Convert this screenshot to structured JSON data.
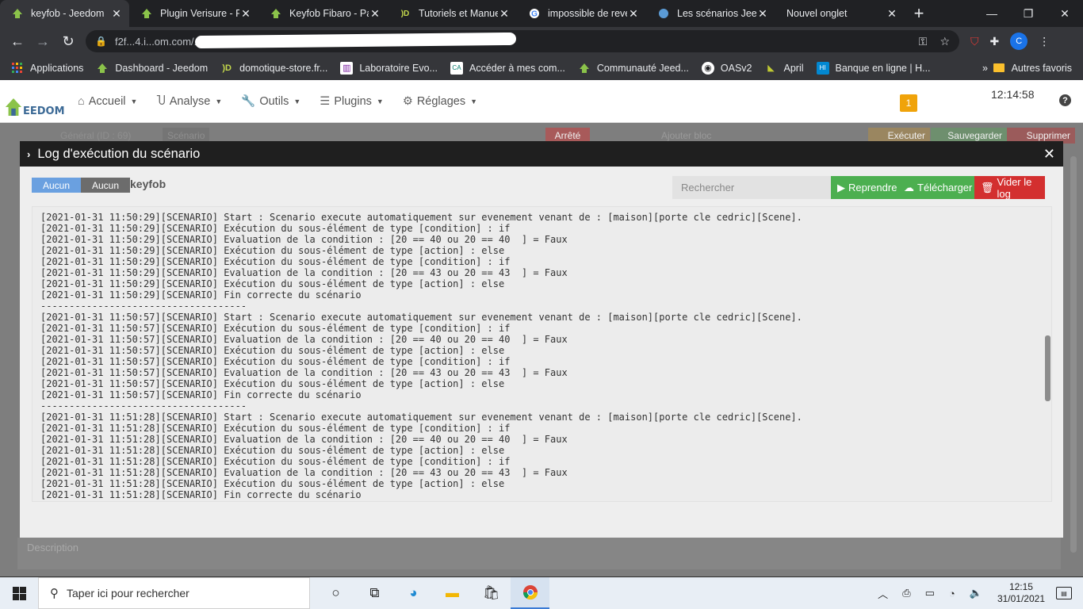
{
  "browser": {
    "tabs": [
      {
        "title": "keyfob - Jeedom",
        "active": true
      },
      {
        "title": "Plugin Verisure - P",
        "active": false
      },
      {
        "title": "Keyfob Fibaro - Pa",
        "active": false
      },
      {
        "title": "Tutoriels et Manue",
        "active": false
      },
      {
        "title": "impossible de reve",
        "active": false
      },
      {
        "title": "Les scénarios Jeed",
        "active": false
      },
      {
        "title": "Nouvel onglet",
        "active": false
      }
    ],
    "address": "f2f...4.i...om.com/...",
    "bookmarks": [
      "Applications",
      "Dashboard - Jeedom",
      "domotique-store.fr...",
      "Laboratoire Evo...",
      "Accéder à mes com...",
      "Communauté Jeed...",
      "OASv2",
      "April",
      "Banque en ligne | H..."
    ],
    "bookmarks_more": "»",
    "other_bookmarks": "Autres favoris",
    "profile_initial": "C"
  },
  "jeedom": {
    "logo_text": "EEDOM",
    "menu": [
      "Accueil",
      "Analyse",
      "Outils",
      "Plugins",
      "Réglages"
    ],
    "badge": "1",
    "clock": "12:14:58",
    "background": {
      "tab_general": "Général (ID : 69)",
      "tab_scenario": "Scénario",
      "state": "Arrêté",
      "add_block": "Ajouter bloc",
      "execute": "Exécuter",
      "save": "Sauvegarder",
      "delete": "Supprimer",
      "description_placeholder": "Description"
    }
  },
  "modal": {
    "title": "Log d'exécution du scénario",
    "filter1": "Aucun",
    "filter2": "Aucun",
    "name": "keyfob",
    "search_placeholder": "Rechercher",
    "resume": "Reprendre",
    "download": "Télécharger",
    "clear": "Vider le log",
    "log_lines": [
      "[2021-01-31 11:50:29][SCENARIO] Start : Scenario execute automatiquement sur evenement venant de : [maison][porte cle cedric][Scene].",
      "[2021-01-31 11:50:29][SCENARIO] Exécution du sous-élément de type [condition] : if",
      "[2021-01-31 11:50:29][SCENARIO] Evaluation de la condition : [20 == 40 ou 20 == 40  ] = Faux",
      "[2021-01-31 11:50:29][SCENARIO] Exécution du sous-élément de type [action] : else",
      "[2021-01-31 11:50:29][SCENARIO] Exécution du sous-élément de type [condition] : if",
      "[2021-01-31 11:50:29][SCENARIO] Evaluation de la condition : [20 == 43 ou 20 == 43  ] = Faux",
      "[2021-01-31 11:50:29][SCENARIO] Exécution du sous-élément de type [action] : else",
      "[2021-01-31 11:50:29][SCENARIO] Fin correcte du scénario",
      "------------------------------------",
      "[2021-01-31 11:50:57][SCENARIO] Start : Scenario execute automatiquement sur evenement venant de : [maison][porte cle cedric][Scene].",
      "[2021-01-31 11:50:57][SCENARIO] Exécution du sous-élément de type [condition] : if",
      "[2021-01-31 11:50:57][SCENARIO] Evaluation de la condition : [20 == 40 ou 20 == 40  ] = Faux",
      "[2021-01-31 11:50:57][SCENARIO] Exécution du sous-élément de type [action] : else",
      "[2021-01-31 11:50:57][SCENARIO] Exécution du sous-élément de type [condition] : if",
      "[2021-01-31 11:50:57][SCENARIO] Evaluation de la condition : [20 == 43 ou 20 == 43  ] = Faux",
      "[2021-01-31 11:50:57][SCENARIO] Exécution du sous-élément de type [action] : else",
      "[2021-01-31 11:50:57][SCENARIO] Fin correcte du scénario",
      "------------------------------------",
      "[2021-01-31 11:51:28][SCENARIO] Start : Scenario execute automatiquement sur evenement venant de : [maison][porte cle cedric][Scene].",
      "[2021-01-31 11:51:28][SCENARIO] Exécution du sous-élément de type [condition] : if",
      "[2021-01-31 11:51:28][SCENARIO] Evaluation de la condition : [20 == 40 ou 20 == 40  ] = Faux",
      "[2021-01-31 11:51:28][SCENARIO] Exécution du sous-élément de type [action] : else",
      "[2021-01-31 11:51:28][SCENARIO] Exécution du sous-élément de type [condition] : if",
      "[2021-01-31 11:51:28][SCENARIO] Evaluation de la condition : [20 == 43 ou 20 == 43  ] = Faux",
      "[2021-01-31 11:51:28][SCENARIO] Exécution du sous-élément de type [action] : else",
      "[2021-01-31 11:51:28][SCENARIO] Fin correcte du scénario"
    ]
  },
  "taskbar": {
    "search_placeholder": "Taper ici pour rechercher",
    "time": "12:15",
    "date": "31/01/2021"
  },
  "colors": {
    "green": "#4caf50",
    "red": "#d32f2f",
    "label_blue": "#6aa0e0",
    "badge_orange": "#f0a30a"
  }
}
